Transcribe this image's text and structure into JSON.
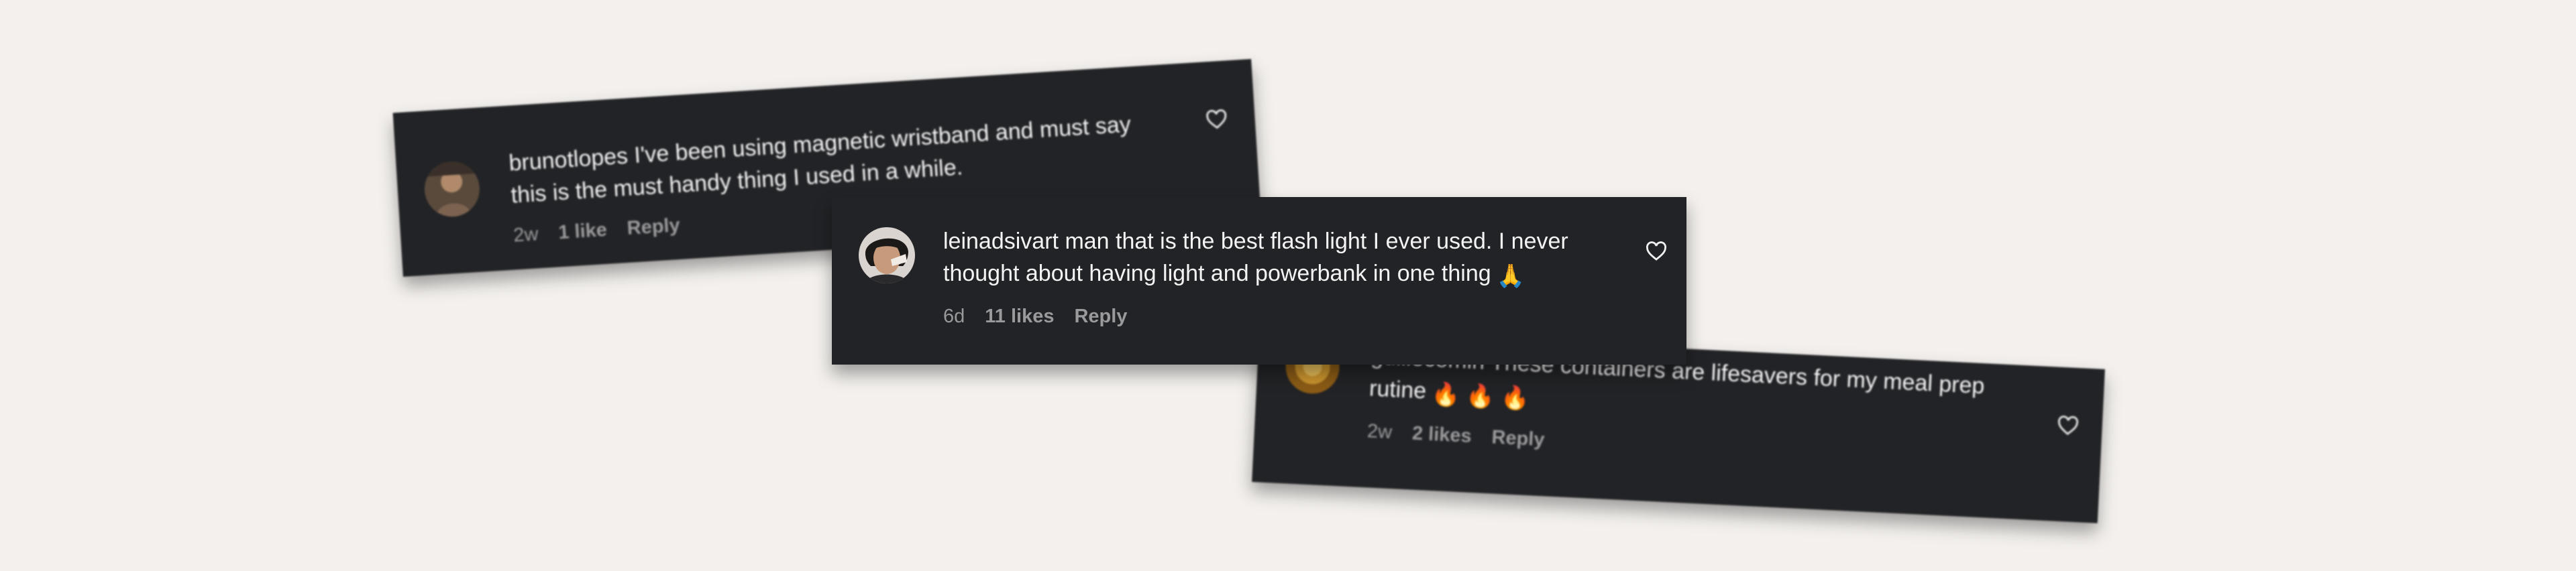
{
  "comments": [
    {
      "username": "brunotlopes",
      "text": "I've been using magnetic wristband and must say this is the must handy thing I used in a while.",
      "line1": "I've been using magnetic wristband and must say",
      "line2": "this is the must handy thing I used in a while.",
      "age": "2w",
      "likes": "1 like",
      "reply_label": "Reply",
      "icon": "heart-outline-icon"
    },
    {
      "username": "leinadsivart",
      "text": "man that is the best flash light I ever used. I never thought about having light and powerbank in one thing",
      "line1": "man that is the best flash light I ever used. I never",
      "line2": "thought about having light and powerbank in one thing",
      "emoji": "🙏",
      "age": "6d",
      "likes": "11 likes",
      "reply_label": "Reply",
      "icon": "heart-outline-icon"
    },
    {
      "username": "guillecomin",
      "text": "These containers are lifesavers for my meal prep rutine",
      "line1": "These containers are lifesavers for my meal prep",
      "line2": "rutine",
      "emoji": "🔥 🔥 🔥",
      "age": "2w",
      "likes": "2 likes",
      "reply_label": "Reply",
      "icon": "heart-outline-icon"
    }
  ],
  "colors": {
    "background": "#f3f0ed",
    "card": "#222326",
    "text": "#f4f4f4",
    "meta": "#9a9a9d"
  }
}
